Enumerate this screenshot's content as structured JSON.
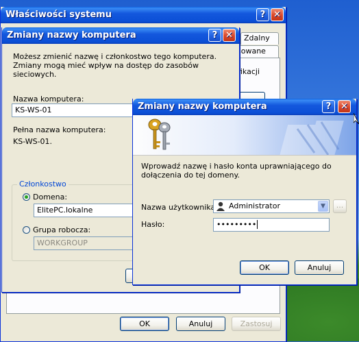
{
  "sys_props": {
    "title": "Właściwości systemu",
    "tab_remote": "Zdalny",
    "tab_partial": "sowane",
    "partial_text": "fikacji",
    "ok": "OK",
    "cancel": "Anuluj",
    "apply": "Zastosuj"
  },
  "rename": {
    "title": "Zmiany nazwy komputera",
    "description": "Możesz zmienić nazwę i członkostwo tego komputera. Zmiany mogą mieć wpływ na dostęp do zasobów sieciowych.",
    "computer_name_label": "Nazwa komputera:",
    "computer_name_value": "KS-WS-01",
    "full_name_label": "Pełna nazwa komputera:",
    "full_name_value": "KS-WS-01.",
    "membership_label": "Członkostwo",
    "domain_label": "Domena:",
    "domain_value": "ElitePC.lokalne",
    "workgroup_label": "Grupa robocza:",
    "workgroup_value": "WORKGROUP"
  },
  "credentials": {
    "title": "Zmiany nazwy komputera",
    "prompt": "Wprowadź nazwę i hasło konta uprawniającego do dołączenia do tej domeny.",
    "username_label": "Nazwa użytkownika:",
    "username_value": "Administrator",
    "browse_label": "...",
    "password_label": "Hasło:",
    "password_value": "•••••••••",
    "ok": "OK",
    "cancel": "Anuluj"
  },
  "colors": {
    "title_blue": "#0b4fd6",
    "dialog_face": "#ece9d8",
    "close_red": "#d9472a"
  }
}
